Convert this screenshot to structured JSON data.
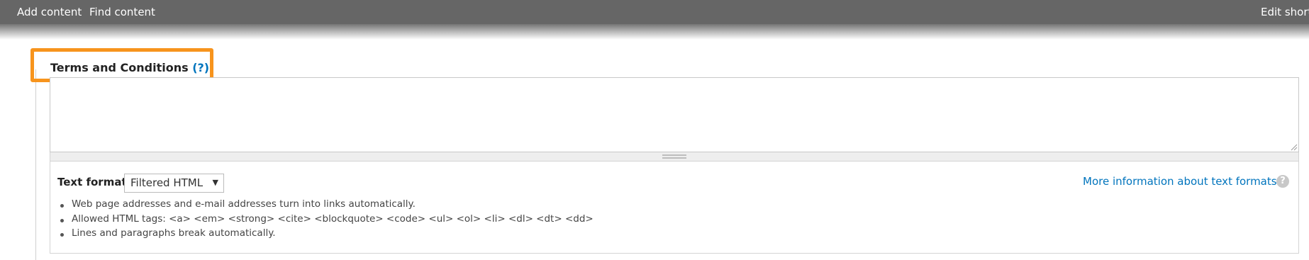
{
  "toolbar": {
    "shortcuts": [
      {
        "label": "Add content"
      },
      {
        "label": "Find content"
      }
    ],
    "edit_shortcuts_label": "Edit short"
  },
  "field": {
    "label": "Terms and Conditions",
    "help_marker": "(?)",
    "value": ""
  },
  "text_format": {
    "label": "Text format",
    "selected": "Filtered HTML",
    "more_info_link": "More information about text formats",
    "help_icon": "?",
    "tips": [
      "Web page addresses and e-mail addresses turn into links automatically.",
      "Allowed HTML tags: <a> <em> <strong> <cite> <blockquote> <code> <ul> <ol> <li> <dl> <dt> <dd>",
      "Lines and paragraphs break automatically."
    ]
  },
  "colors": {
    "toolbar_bg": "#666666",
    "highlight": "#f7941d",
    "link": "#0074bd"
  }
}
